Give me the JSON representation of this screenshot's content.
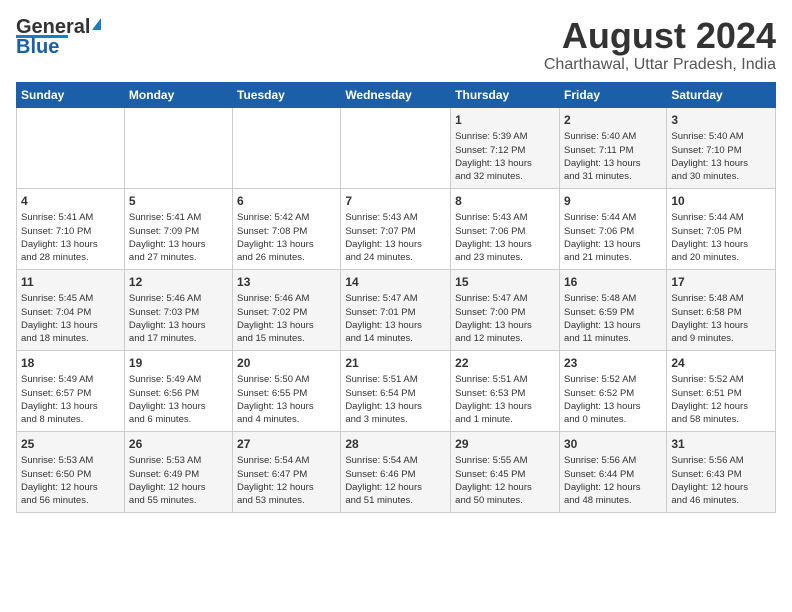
{
  "logo": {
    "line1": "General",
    "line2": "Blue"
  },
  "title": "August 2024",
  "subtitle": "Charthawal, Uttar Pradesh, India",
  "days_of_week": [
    "Sunday",
    "Monday",
    "Tuesday",
    "Wednesday",
    "Thursday",
    "Friday",
    "Saturday"
  ],
  "weeks": [
    [
      {
        "day": "",
        "info": ""
      },
      {
        "day": "",
        "info": ""
      },
      {
        "day": "",
        "info": ""
      },
      {
        "day": "",
        "info": ""
      },
      {
        "day": "1",
        "info": "Sunrise: 5:39 AM\nSunset: 7:12 PM\nDaylight: 13 hours\nand 32 minutes."
      },
      {
        "day": "2",
        "info": "Sunrise: 5:40 AM\nSunset: 7:11 PM\nDaylight: 13 hours\nand 31 minutes."
      },
      {
        "day": "3",
        "info": "Sunrise: 5:40 AM\nSunset: 7:10 PM\nDaylight: 13 hours\nand 30 minutes."
      }
    ],
    [
      {
        "day": "4",
        "info": "Sunrise: 5:41 AM\nSunset: 7:10 PM\nDaylight: 13 hours\nand 28 minutes."
      },
      {
        "day": "5",
        "info": "Sunrise: 5:41 AM\nSunset: 7:09 PM\nDaylight: 13 hours\nand 27 minutes."
      },
      {
        "day": "6",
        "info": "Sunrise: 5:42 AM\nSunset: 7:08 PM\nDaylight: 13 hours\nand 26 minutes."
      },
      {
        "day": "7",
        "info": "Sunrise: 5:43 AM\nSunset: 7:07 PM\nDaylight: 13 hours\nand 24 minutes."
      },
      {
        "day": "8",
        "info": "Sunrise: 5:43 AM\nSunset: 7:06 PM\nDaylight: 13 hours\nand 23 minutes."
      },
      {
        "day": "9",
        "info": "Sunrise: 5:44 AM\nSunset: 7:06 PM\nDaylight: 13 hours\nand 21 minutes."
      },
      {
        "day": "10",
        "info": "Sunrise: 5:44 AM\nSunset: 7:05 PM\nDaylight: 13 hours\nand 20 minutes."
      }
    ],
    [
      {
        "day": "11",
        "info": "Sunrise: 5:45 AM\nSunset: 7:04 PM\nDaylight: 13 hours\nand 18 minutes."
      },
      {
        "day": "12",
        "info": "Sunrise: 5:46 AM\nSunset: 7:03 PM\nDaylight: 13 hours\nand 17 minutes."
      },
      {
        "day": "13",
        "info": "Sunrise: 5:46 AM\nSunset: 7:02 PM\nDaylight: 13 hours\nand 15 minutes."
      },
      {
        "day": "14",
        "info": "Sunrise: 5:47 AM\nSunset: 7:01 PM\nDaylight: 13 hours\nand 14 minutes."
      },
      {
        "day": "15",
        "info": "Sunrise: 5:47 AM\nSunset: 7:00 PM\nDaylight: 13 hours\nand 12 minutes."
      },
      {
        "day": "16",
        "info": "Sunrise: 5:48 AM\nSunset: 6:59 PM\nDaylight: 13 hours\nand 11 minutes."
      },
      {
        "day": "17",
        "info": "Sunrise: 5:48 AM\nSunset: 6:58 PM\nDaylight: 13 hours\nand 9 minutes."
      }
    ],
    [
      {
        "day": "18",
        "info": "Sunrise: 5:49 AM\nSunset: 6:57 PM\nDaylight: 13 hours\nand 8 minutes."
      },
      {
        "day": "19",
        "info": "Sunrise: 5:49 AM\nSunset: 6:56 PM\nDaylight: 13 hours\nand 6 minutes."
      },
      {
        "day": "20",
        "info": "Sunrise: 5:50 AM\nSunset: 6:55 PM\nDaylight: 13 hours\nand 4 minutes."
      },
      {
        "day": "21",
        "info": "Sunrise: 5:51 AM\nSunset: 6:54 PM\nDaylight: 13 hours\nand 3 minutes."
      },
      {
        "day": "22",
        "info": "Sunrise: 5:51 AM\nSunset: 6:53 PM\nDaylight: 13 hours\nand 1 minute."
      },
      {
        "day": "23",
        "info": "Sunrise: 5:52 AM\nSunset: 6:52 PM\nDaylight: 13 hours\nand 0 minutes."
      },
      {
        "day": "24",
        "info": "Sunrise: 5:52 AM\nSunset: 6:51 PM\nDaylight: 12 hours\nand 58 minutes."
      }
    ],
    [
      {
        "day": "25",
        "info": "Sunrise: 5:53 AM\nSunset: 6:50 PM\nDaylight: 12 hours\nand 56 minutes."
      },
      {
        "day": "26",
        "info": "Sunrise: 5:53 AM\nSunset: 6:49 PM\nDaylight: 12 hours\nand 55 minutes."
      },
      {
        "day": "27",
        "info": "Sunrise: 5:54 AM\nSunset: 6:47 PM\nDaylight: 12 hours\nand 53 minutes."
      },
      {
        "day": "28",
        "info": "Sunrise: 5:54 AM\nSunset: 6:46 PM\nDaylight: 12 hours\nand 51 minutes."
      },
      {
        "day": "29",
        "info": "Sunrise: 5:55 AM\nSunset: 6:45 PM\nDaylight: 12 hours\nand 50 minutes."
      },
      {
        "day": "30",
        "info": "Sunrise: 5:56 AM\nSunset: 6:44 PM\nDaylight: 12 hours\nand 48 minutes."
      },
      {
        "day": "31",
        "info": "Sunrise: 5:56 AM\nSunset: 6:43 PM\nDaylight: 12 hours\nand 46 minutes."
      }
    ]
  ]
}
